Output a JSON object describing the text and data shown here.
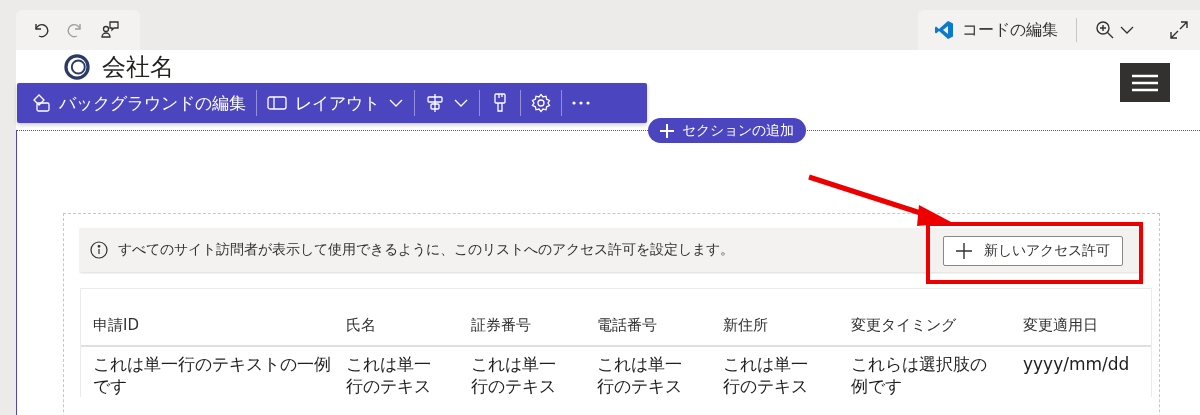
{
  "editor_bar": {
    "edit_code": "コードの編集"
  },
  "site_header": {
    "company_name": "会社名"
  },
  "section_toolbar": {
    "edit_background": "バックグラウンドの編集",
    "layout": "レイアウト"
  },
  "add_section": "セクションの追加",
  "info_bar": {
    "message": "すべてのサイト訪問者が表示して使用できるように、このリストへのアクセス許可を設定します。",
    "button": "新しいアクセス許可"
  },
  "table": {
    "columns": [
      "申請ID",
      "氏名",
      "証券番号",
      "電話番号",
      "新住所",
      "変更タイミング",
      "変更適用日"
    ],
    "rows": [
      [
        "これは単一行のテキストの一例です",
        "これは単一行のテキス",
        "これは単一行のテキス",
        "これは単一行のテキス",
        "これは単一行のテキス",
        "これらは選択肢の例です",
        "yyyy/mm/dd"
      ]
    ]
  }
}
